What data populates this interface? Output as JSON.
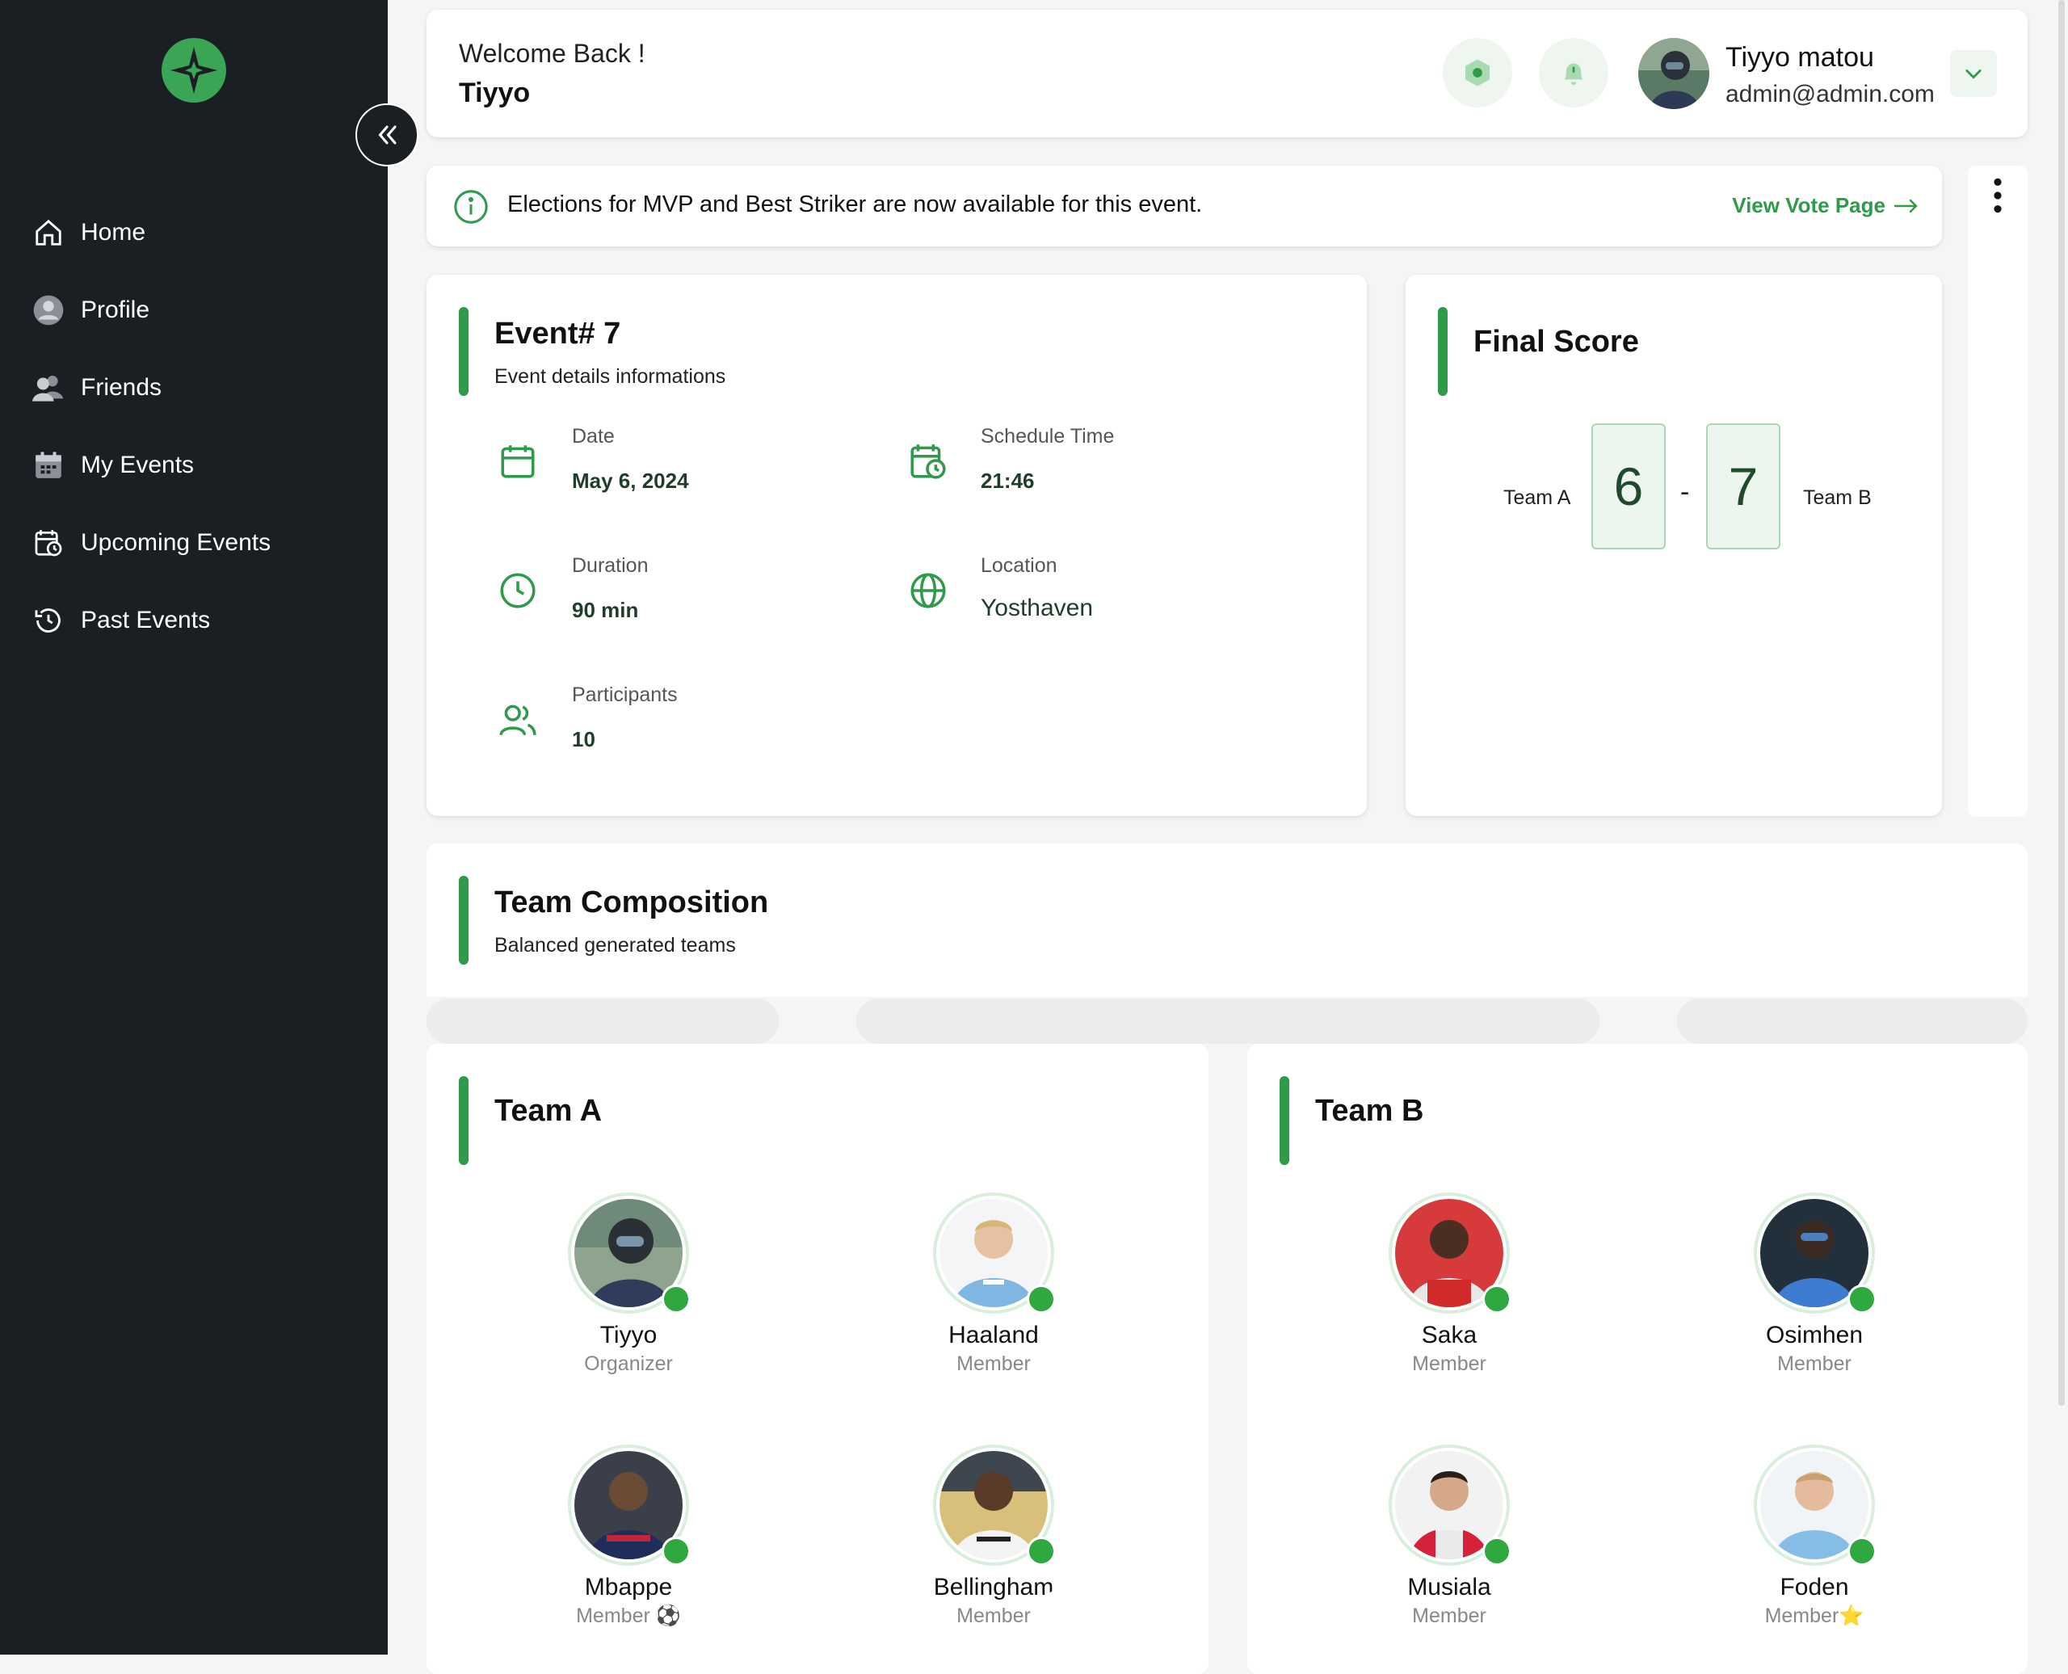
{
  "sidebar": {
    "items": [
      {
        "label": "Home",
        "icon": "home-icon"
      },
      {
        "label": "Profile",
        "icon": "user-icon"
      },
      {
        "label": "Friends",
        "icon": "friends-icon"
      },
      {
        "label": "My Events",
        "icon": "calendar-grid-icon"
      },
      {
        "label": "Upcoming Events",
        "icon": "calendar-clock-icon"
      },
      {
        "label": "Past Events",
        "icon": "history-icon"
      }
    ]
  },
  "header": {
    "welcome": "Welcome Back !",
    "name": "Tiyyo",
    "user_name": "Tiyyo matou",
    "user_email": "admin@admin.com"
  },
  "banner": {
    "text": "Elections for MVP and Best Striker are now available for this event.",
    "link": "View Vote Page"
  },
  "event": {
    "title": "Event# 7",
    "subtitle": "Event details informations",
    "date_label": "Date",
    "date": "May 6, 2024",
    "time_label": "Schedule Time",
    "time": "21:46",
    "duration_label": "Duration",
    "duration": "90 min",
    "location_label": "Location",
    "location": "Yosthaven",
    "participants_label": "Participants",
    "participants": "10"
  },
  "score": {
    "title": "Final Score",
    "team_a": "Team A",
    "team_b": "Team B",
    "score_a": "6",
    "separator": "-",
    "score_b": "7"
  },
  "composition": {
    "title": "Team Composition",
    "subtitle": "Balanced generated teams"
  },
  "team_a": {
    "title": "Team A",
    "players": [
      {
        "name": "Tiyyo",
        "role": "Organizer",
        "badge": ""
      },
      {
        "name": "Haaland",
        "role": "Member",
        "badge": ""
      },
      {
        "name": "Mbappe",
        "role": "Member",
        "badge": "⚽"
      },
      {
        "name": "Bellingham",
        "role": "Member",
        "badge": ""
      }
    ]
  },
  "team_b": {
    "title": "Team B",
    "players": [
      {
        "name": "Saka",
        "role": "Member",
        "badge": ""
      },
      {
        "name": "Osimhen",
        "role": "Member",
        "badge": ""
      },
      {
        "name": "Musiala",
        "role": "Member",
        "badge": ""
      },
      {
        "name": "Foden",
        "role": "Member",
        "badge": "⭐"
      }
    ]
  },
  "colors": {
    "accent": "#2e9a4a",
    "sidebar": "#1b1f24",
    "check": "#2ea83f"
  }
}
